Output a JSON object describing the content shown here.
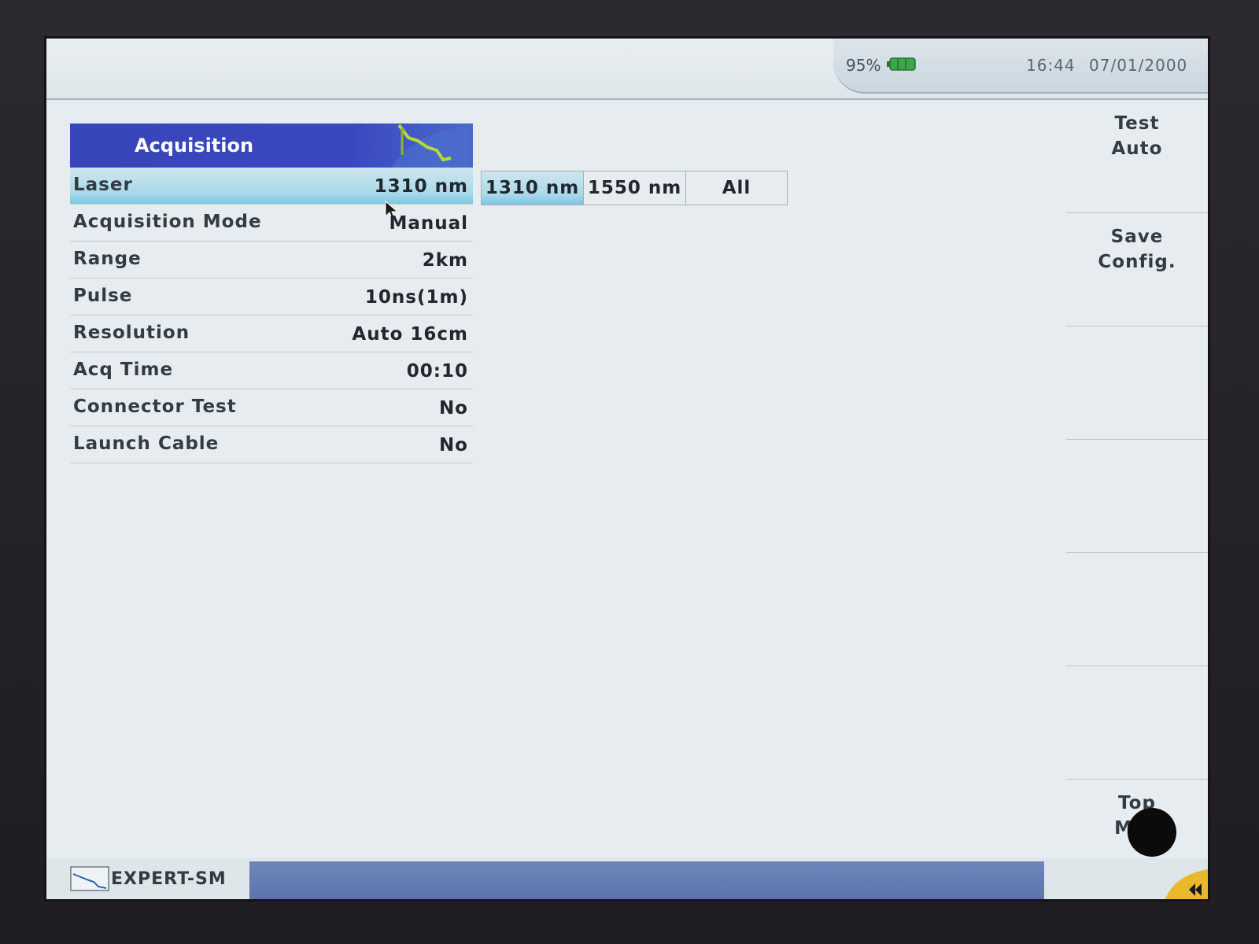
{
  "status": {
    "battery_percent": "95%",
    "time": "16:44",
    "date": "07/01/2000",
    "battery_color": "#3aa84a"
  },
  "panel": {
    "title": "Acquisition",
    "rows": [
      {
        "label": "Laser",
        "value": "1310 nm"
      },
      {
        "label": "Acquisition Mode",
        "value": "Manual"
      },
      {
        "label": "Range",
        "value": "2km"
      },
      {
        "label": "Pulse",
        "value": "10ns(1m)"
      },
      {
        "label": "Resolution",
        "value": "Auto 16cm"
      },
      {
        "label": "Acq Time",
        "value": "00:10"
      },
      {
        "label": "Connector Test",
        "value": "No"
      },
      {
        "label": "Launch Cable",
        "value": "No"
      }
    ]
  },
  "laser_options": [
    "1310 nm",
    "1550 nm",
    "All"
  ],
  "softkeys": {
    "key1_line1": "Test",
    "key1_line2": "Auto",
    "key2_line1": "Save",
    "key2_line2": "Config.",
    "key_last_line1": "Top",
    "key_last_line2": "Men"
  },
  "footer": {
    "mode_label": "EXPERT-SM"
  },
  "colors": {
    "header_blue": "#3746b8",
    "selection_cyan": "#7cc6e2",
    "progress_blue": "#5a72ad"
  },
  "icons": {
    "header_graphic": "otdr-trace-icon",
    "mode": "otdr-trace-icon",
    "back": "rewind-icon",
    "battery": "battery-icon"
  }
}
